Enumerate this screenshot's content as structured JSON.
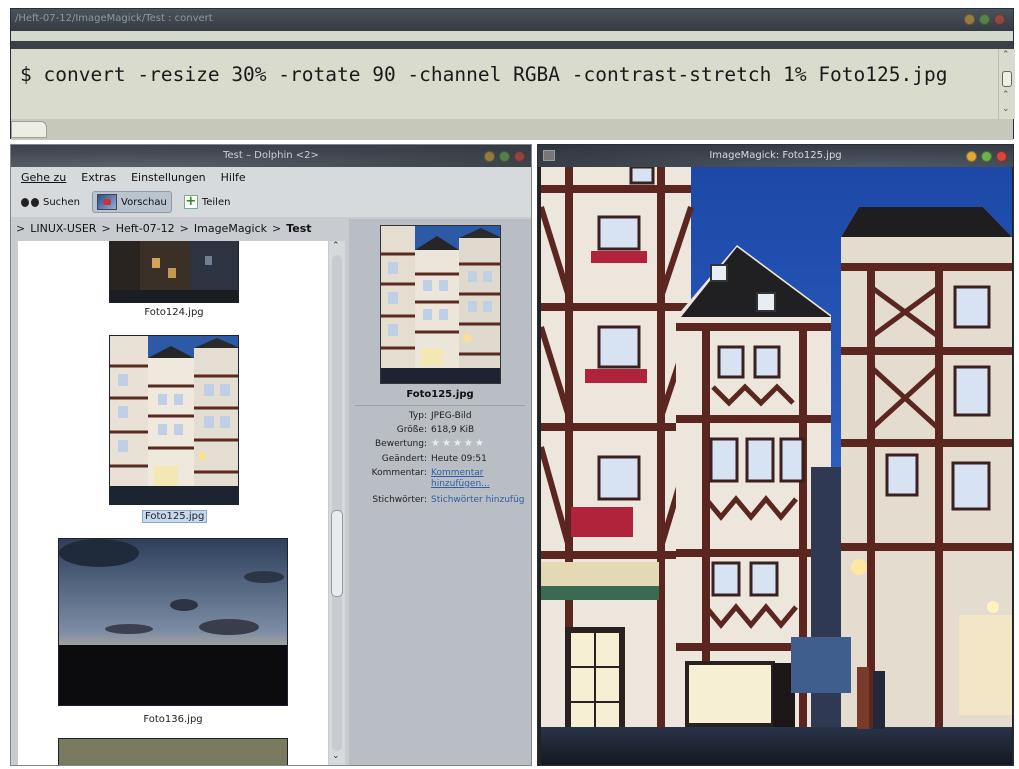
{
  "terminal": {
    "title": "/Heft-07-12/ImageMagick/Test : convert",
    "command": "$ convert -resize 30% -rotate 90 -channel RGBA -contrast-stretch 1% Foto125.jpg"
  },
  "dolphin": {
    "title": "Test – Dolphin <2>",
    "menu": [
      {
        "label": "Gehe zu"
      },
      {
        "label": "Extras"
      },
      {
        "label": "Einstellungen"
      },
      {
        "label": "Hilfe"
      }
    ],
    "toolbar": {
      "search_label": "Suchen",
      "preview_label": "Vorschau",
      "share_label": "Teilen"
    },
    "breadcrumb": [
      {
        "label": "LINUX-USER"
      },
      {
        "label": "Heft-07-12"
      },
      {
        "label": "ImageMagick"
      },
      {
        "label": "Test"
      }
    ],
    "files": [
      {
        "name": "Foto124.jpg"
      },
      {
        "name": "Foto125.jpg"
      },
      {
        "name": "Foto136.jpg"
      }
    ],
    "info": {
      "file_name": "Foto125.jpg",
      "type_key": "Typ:",
      "type_value": "JPEG-Bild",
      "size_key": "Größe:",
      "size_value": "618,9 KiB",
      "rating_key": "Bewertung:",
      "changed_key": "Geändert:",
      "changed_value": "Heute 09:51",
      "comment_key": "Kommentar:",
      "comment_value_1": "Kommentar",
      "comment_value_2": "hinzufügen...",
      "keywords_key": "Stichwörter:",
      "keywords_value": "Stichwörter hinzufüg"
    }
  },
  "imagemagick": {
    "title": "ImageMagick: Foto125.jpg"
  },
  "colors": {
    "window_close": "#d8473b",
    "window_min": "#e0a83a",
    "window_max": "#6cb24a",
    "selection": "#c6d9ef",
    "link": "#2f5fa8"
  }
}
